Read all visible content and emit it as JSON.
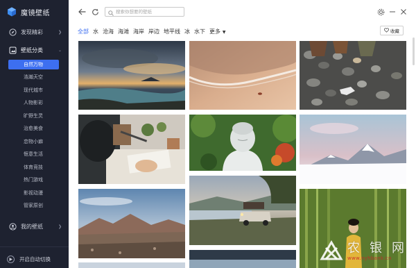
{
  "app": {
    "title": "魔镜壁纸"
  },
  "sidebar": {
    "discover": {
      "label": "发现精彩",
      "icon": "compass-icon"
    },
    "category": {
      "label": "壁纸分类",
      "icon": "grid-icon"
    },
    "sub_items": [
      {
        "label": "自然万物",
        "active": true
      },
      {
        "label": "浩瀚天空"
      },
      {
        "label": "现代城市"
      },
      {
        "label": "人物影彩"
      },
      {
        "label": "旷野生灵"
      },
      {
        "label": "治愈美食"
      },
      {
        "label": "恋物小癖"
      },
      {
        "label": "惬意生活"
      },
      {
        "label": "体育竞技"
      },
      {
        "label": "热门游戏"
      },
      {
        "label": "影视动漫"
      },
      {
        "label": "管家原创"
      }
    ],
    "mine": {
      "label": "我的壁纸",
      "icon": "user-icon"
    },
    "autoswitch": {
      "label": "开启自动切换",
      "icon": "play-icon"
    }
  },
  "search": {
    "placeholder": "搜索你想要的壁纸"
  },
  "tabs": [
    {
      "label": "全部",
      "active": true
    },
    {
      "label": "水"
    },
    {
      "label": "沧海"
    },
    {
      "label": "海滩"
    },
    {
      "label": "海岸"
    },
    {
      "label": "岸边"
    },
    {
      "label": "地平线"
    },
    {
      "label": "冰"
    },
    {
      "label": "水下"
    },
    {
      "label": "更多"
    }
  ],
  "favorite": {
    "label": "收藏",
    "icon": "heart-icon"
  },
  "colors": {
    "accent": "#3d6ff0",
    "sidebar_bg": "#1e2230"
  },
  "watermark": {
    "text": "农银网",
    "url": "www.nyhbank.cn"
  }
}
